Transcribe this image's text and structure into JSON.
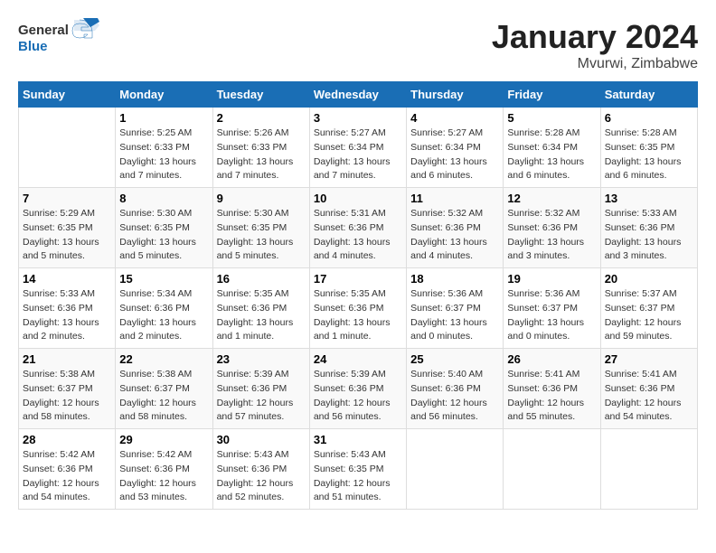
{
  "header": {
    "logo_general": "General",
    "logo_blue": "Blue",
    "month_title": "January 2024",
    "location": "Mvurwi, Zimbabwe"
  },
  "weekdays": [
    "Sunday",
    "Monday",
    "Tuesday",
    "Wednesday",
    "Thursday",
    "Friday",
    "Saturday"
  ],
  "weeks": [
    [
      {
        "day": "",
        "sunrise": "",
        "sunset": "",
        "daylight": ""
      },
      {
        "day": "1",
        "sunrise": "Sunrise: 5:25 AM",
        "sunset": "Sunset: 6:33 PM",
        "daylight": "Daylight: 13 hours and 7 minutes."
      },
      {
        "day": "2",
        "sunrise": "Sunrise: 5:26 AM",
        "sunset": "Sunset: 6:33 PM",
        "daylight": "Daylight: 13 hours and 7 minutes."
      },
      {
        "day": "3",
        "sunrise": "Sunrise: 5:27 AM",
        "sunset": "Sunset: 6:34 PM",
        "daylight": "Daylight: 13 hours and 7 minutes."
      },
      {
        "day": "4",
        "sunrise": "Sunrise: 5:27 AM",
        "sunset": "Sunset: 6:34 PM",
        "daylight": "Daylight: 13 hours and 6 minutes."
      },
      {
        "day": "5",
        "sunrise": "Sunrise: 5:28 AM",
        "sunset": "Sunset: 6:34 PM",
        "daylight": "Daylight: 13 hours and 6 minutes."
      },
      {
        "day": "6",
        "sunrise": "Sunrise: 5:28 AM",
        "sunset": "Sunset: 6:35 PM",
        "daylight": "Daylight: 13 hours and 6 minutes."
      }
    ],
    [
      {
        "day": "7",
        "sunrise": "Sunrise: 5:29 AM",
        "sunset": "Sunset: 6:35 PM",
        "daylight": "Daylight: 13 hours and 5 minutes."
      },
      {
        "day": "8",
        "sunrise": "Sunrise: 5:30 AM",
        "sunset": "Sunset: 6:35 PM",
        "daylight": "Daylight: 13 hours and 5 minutes."
      },
      {
        "day": "9",
        "sunrise": "Sunrise: 5:30 AM",
        "sunset": "Sunset: 6:35 PM",
        "daylight": "Daylight: 13 hours and 5 minutes."
      },
      {
        "day": "10",
        "sunrise": "Sunrise: 5:31 AM",
        "sunset": "Sunset: 6:36 PM",
        "daylight": "Daylight: 13 hours and 4 minutes."
      },
      {
        "day": "11",
        "sunrise": "Sunrise: 5:32 AM",
        "sunset": "Sunset: 6:36 PM",
        "daylight": "Daylight: 13 hours and 4 minutes."
      },
      {
        "day": "12",
        "sunrise": "Sunrise: 5:32 AM",
        "sunset": "Sunset: 6:36 PM",
        "daylight": "Daylight: 13 hours and 3 minutes."
      },
      {
        "day": "13",
        "sunrise": "Sunrise: 5:33 AM",
        "sunset": "Sunset: 6:36 PM",
        "daylight": "Daylight: 13 hours and 3 minutes."
      }
    ],
    [
      {
        "day": "14",
        "sunrise": "Sunrise: 5:33 AM",
        "sunset": "Sunset: 6:36 PM",
        "daylight": "Daylight: 13 hours and 2 minutes."
      },
      {
        "day": "15",
        "sunrise": "Sunrise: 5:34 AM",
        "sunset": "Sunset: 6:36 PM",
        "daylight": "Daylight: 13 hours and 2 minutes."
      },
      {
        "day": "16",
        "sunrise": "Sunrise: 5:35 AM",
        "sunset": "Sunset: 6:36 PM",
        "daylight": "Daylight: 13 hours and 1 minute."
      },
      {
        "day": "17",
        "sunrise": "Sunrise: 5:35 AM",
        "sunset": "Sunset: 6:36 PM",
        "daylight": "Daylight: 13 hours and 1 minute."
      },
      {
        "day": "18",
        "sunrise": "Sunrise: 5:36 AM",
        "sunset": "Sunset: 6:37 PM",
        "daylight": "Daylight: 13 hours and 0 minutes."
      },
      {
        "day": "19",
        "sunrise": "Sunrise: 5:36 AM",
        "sunset": "Sunset: 6:37 PM",
        "daylight": "Daylight: 13 hours and 0 minutes."
      },
      {
        "day": "20",
        "sunrise": "Sunrise: 5:37 AM",
        "sunset": "Sunset: 6:37 PM",
        "daylight": "Daylight: 12 hours and 59 minutes."
      }
    ],
    [
      {
        "day": "21",
        "sunrise": "Sunrise: 5:38 AM",
        "sunset": "Sunset: 6:37 PM",
        "daylight": "Daylight: 12 hours and 58 minutes."
      },
      {
        "day": "22",
        "sunrise": "Sunrise: 5:38 AM",
        "sunset": "Sunset: 6:37 PM",
        "daylight": "Daylight: 12 hours and 58 minutes."
      },
      {
        "day": "23",
        "sunrise": "Sunrise: 5:39 AM",
        "sunset": "Sunset: 6:36 PM",
        "daylight": "Daylight: 12 hours and 57 minutes."
      },
      {
        "day": "24",
        "sunrise": "Sunrise: 5:39 AM",
        "sunset": "Sunset: 6:36 PM",
        "daylight": "Daylight: 12 hours and 56 minutes."
      },
      {
        "day": "25",
        "sunrise": "Sunrise: 5:40 AM",
        "sunset": "Sunset: 6:36 PM",
        "daylight": "Daylight: 12 hours and 56 minutes."
      },
      {
        "day": "26",
        "sunrise": "Sunrise: 5:41 AM",
        "sunset": "Sunset: 6:36 PM",
        "daylight": "Daylight: 12 hours and 55 minutes."
      },
      {
        "day": "27",
        "sunrise": "Sunrise: 5:41 AM",
        "sunset": "Sunset: 6:36 PM",
        "daylight": "Daylight: 12 hours and 54 minutes."
      }
    ],
    [
      {
        "day": "28",
        "sunrise": "Sunrise: 5:42 AM",
        "sunset": "Sunset: 6:36 PM",
        "daylight": "Daylight: 12 hours and 54 minutes."
      },
      {
        "day": "29",
        "sunrise": "Sunrise: 5:42 AM",
        "sunset": "Sunset: 6:36 PM",
        "daylight": "Daylight: 12 hours and 53 minutes."
      },
      {
        "day": "30",
        "sunrise": "Sunrise: 5:43 AM",
        "sunset": "Sunset: 6:36 PM",
        "daylight": "Daylight: 12 hours and 52 minutes."
      },
      {
        "day": "31",
        "sunrise": "Sunrise: 5:43 AM",
        "sunset": "Sunset: 6:35 PM",
        "daylight": "Daylight: 12 hours and 51 minutes."
      },
      {
        "day": "",
        "sunrise": "",
        "sunset": "",
        "daylight": ""
      },
      {
        "day": "",
        "sunrise": "",
        "sunset": "",
        "daylight": ""
      },
      {
        "day": "",
        "sunrise": "",
        "sunset": "",
        "daylight": ""
      }
    ]
  ]
}
